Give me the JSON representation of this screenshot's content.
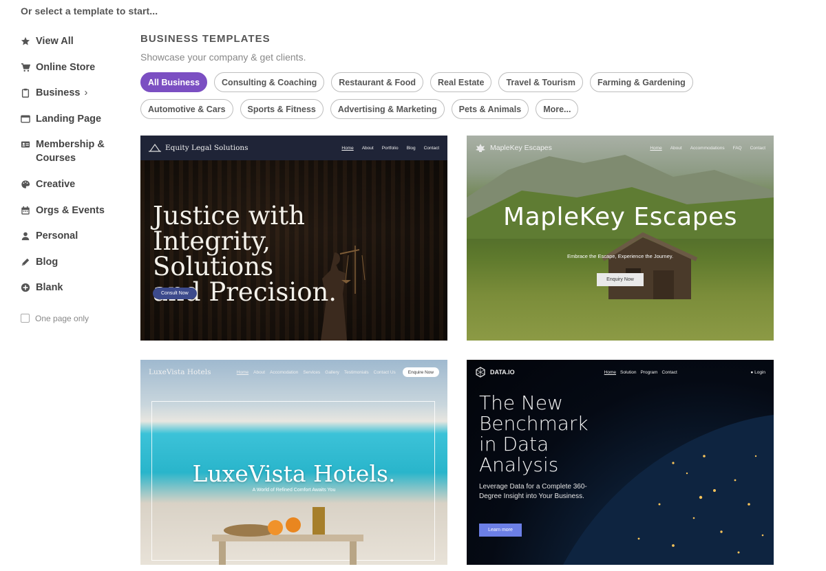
{
  "prompt": "Or select a template to start...",
  "sidebar": {
    "items": [
      {
        "label": "View All",
        "icon": "star-icon"
      },
      {
        "label": "Online Store",
        "icon": "cart-icon"
      },
      {
        "label": "Business",
        "icon": "clipboard-icon",
        "chevron": "›"
      },
      {
        "label": "Landing Page",
        "icon": "window-icon"
      },
      {
        "label": "Membership & Courses",
        "icon": "id-card-icon"
      },
      {
        "label": "Creative",
        "icon": "palette-icon"
      },
      {
        "label": "Orgs & Events",
        "icon": "calendar-icon"
      },
      {
        "label": "Personal",
        "icon": "person-icon"
      },
      {
        "label": "Blog",
        "icon": "pen-icon"
      },
      {
        "label": "Blank",
        "icon": "plus-circle-icon"
      }
    ],
    "one_page_label": "One page only"
  },
  "section": {
    "title": "BUSINESS TEMPLATES",
    "subtitle": "Showcase your company & get clients."
  },
  "chips": [
    "All Business",
    "Consulting & Coaching",
    "Restaurant & Food",
    "Real Estate",
    "Travel & Tourism",
    "Farming & Gardening",
    "Automotive & Cars",
    "Sports & Fitness",
    "Advertising & Marketing",
    "Pets & Animals",
    "More..."
  ],
  "active_chip": "All Business",
  "accent_color": "#7b4fc2",
  "templates": {
    "legal": {
      "brand": "Equity Legal Solutions",
      "links": [
        "Home",
        "About",
        "Portfolio",
        "Blog",
        "Contact"
      ],
      "headline_1": "Justice with",
      "headline_2": "Integrity, Solutions",
      "headline_3": "and Precision.",
      "cta": "Consult Now"
    },
    "maple": {
      "brand": "MapleKey Escapes",
      "links": [
        "Home",
        "About",
        "Accommodations",
        "FAQ",
        "Contact"
      ],
      "headline": "MapleKey Escapes",
      "tagline": "Embrace the Escape, Experience the Journey.",
      "cta": "Enquiry Now"
    },
    "luxe": {
      "brand": "LuxeVista Hotels",
      "links": [
        "Home",
        "About",
        "Accomodation",
        "Services",
        "Gallery",
        "Testimonials",
        "Contact Us"
      ],
      "nav_cta": "Enquire Now",
      "headline": "LuxeVista Hotels.",
      "tagline": "A World of Refined Comfort Awaits You"
    },
    "data": {
      "brand": "DATA.IO",
      "links": [
        "Home",
        "Solution",
        "Program",
        "Contact"
      ],
      "login": "Login",
      "headline_1": "The New",
      "headline_2": "Benchmark",
      "headline_3": "in Data",
      "headline_4": "Analysis",
      "tagline": "Leverage Data for a Complete 360-Degree Insight into Your Business.",
      "cta": "Learn more"
    }
  }
}
